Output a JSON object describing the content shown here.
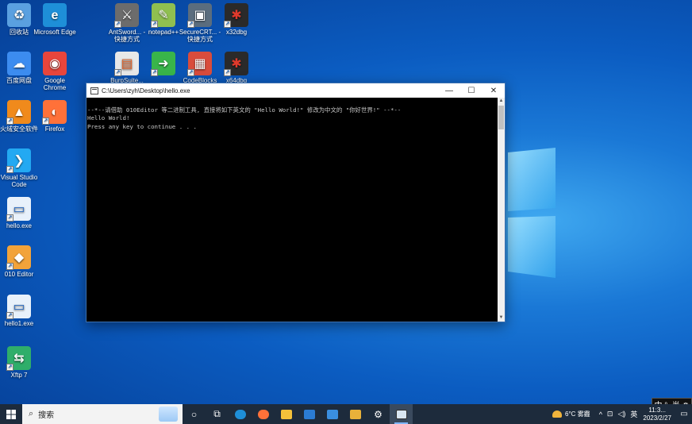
{
  "desktop": {
    "icons": [
      {
        "label": "回收站",
        "color": "#5aa0e0",
        "glyph": "recycle-bin"
      },
      {
        "label": "Microsoft Edge",
        "color": "#1e8fd8",
        "glyph": "edge"
      },
      {
        "label": "AntSword... - 快捷方式",
        "color": "#6c6c6c",
        "glyph": "antsword"
      },
      {
        "label": "notepad++",
        "color": "#8fbf50",
        "glyph": "notepad-plus"
      },
      {
        "label": "SecureCRT... - 快捷方式",
        "color": "#5b6d7e",
        "glyph": "securecrt"
      },
      {
        "label": "x32dbg",
        "color": "#2a2a2a",
        "glyph": "bug"
      },
      {
        "label": "百度网盘",
        "color": "#3c8cf0",
        "glyph": "baidu-netdisk"
      },
      {
        "label": "Google Chrome",
        "color": "#e8453c",
        "glyph": "chrome"
      },
      {
        "label": "BurpSuite...",
        "color": "#e8e8e8",
        "glyph": "burpsuite"
      },
      {
        "label": "",
        "color": "#39b54a",
        "glyph": "arrow"
      },
      {
        "label": "CodeBlocks",
        "color": "#d94c3c",
        "glyph": "codeblocks"
      },
      {
        "label": "x64dbg",
        "color": "#2a2a2a",
        "glyph": "bug"
      },
      {
        "label": "火绒安全软件",
        "color": "#f08a1c",
        "glyph": "huorong"
      },
      {
        "label": "Firefox",
        "color": "#ff7139",
        "glyph": "firefox"
      },
      {
        "label": "Visual Studio Code",
        "color": "#23a9f2",
        "glyph": "vscode"
      },
      {
        "label": "hello.exe",
        "color": "#e8f1fb",
        "glyph": "exe"
      },
      {
        "label": "010 Editor",
        "color": "#f2a33a",
        "glyph": "010editor"
      },
      {
        "label": "hello1.exe",
        "color": "#e8f1fb",
        "glyph": "exe"
      },
      {
        "label": "Xftp 7",
        "color": "#2fae6a",
        "glyph": "xftp"
      }
    ]
  },
  "console": {
    "title": "C:\\Users\\zyh\\Desktop\\hello.exe",
    "lines": [
      "--*--请借助 010Editor 等二进制工具, 直接将如下英文的 \"Hello World!\" 修改为中文的 \"你好世界!\" --*--",
      "",
      "Hello World!",
      "",
      "Press any key to continue . . ."
    ],
    "minimize": "—",
    "maximize": "☐",
    "close": "✕"
  },
  "ime": {
    "text": "中 °, 半 ⚙"
  },
  "taskbar": {
    "search_placeholder": "搜索",
    "weather_temp": "6°C",
    "weather_desc": "雾霾",
    "lang": "英",
    "time": "11:3...",
    "date": "2023/2/27"
  }
}
